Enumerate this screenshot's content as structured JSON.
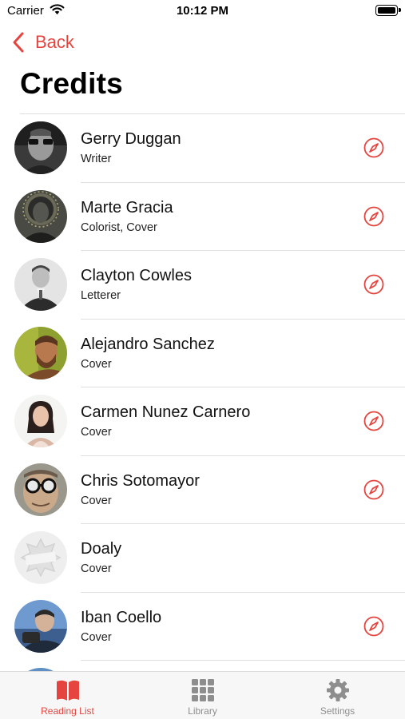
{
  "status_bar": {
    "carrier": "Carrier",
    "time": "10:12 PM"
  },
  "nav": {
    "back_label": "Back",
    "title": "Credits"
  },
  "colors": {
    "accent": "#e6453f",
    "inactive": "#8e8e8e"
  },
  "credits": [
    {
      "name": "Gerry Duggan",
      "role": "Writer",
      "has_link": true,
      "avatar": "portrait-dark-glasses"
    },
    {
      "name": "Marte Gracia",
      "role": "Colorist, Cover",
      "has_link": true,
      "avatar": "portrait-illustrated"
    },
    {
      "name": "Clayton Cowles",
      "role": "Letterer",
      "has_link": true,
      "avatar": "portrait-suit-bw"
    },
    {
      "name": "Alejandro Sanchez",
      "role": "Cover",
      "has_link": false,
      "avatar": "portrait-green-bg"
    },
    {
      "name": "Carmen Nunez Carnero",
      "role": "Cover",
      "has_link": true,
      "avatar": "portrait-woman"
    },
    {
      "name": "Chris Sotomayor",
      "role": "Cover",
      "has_link": true,
      "avatar": "portrait-round-glasses"
    },
    {
      "name": "Doaly",
      "role": "Cover",
      "has_link": false,
      "avatar": "blank-placeholder"
    },
    {
      "name": "Iban Coello",
      "role": "Cover",
      "has_link": true,
      "avatar": "portrait-blue-bg"
    }
  ],
  "tabs": [
    {
      "label": "Reading List",
      "icon": "book-icon",
      "active": true
    },
    {
      "label": "Library",
      "icon": "grid-icon",
      "active": false
    },
    {
      "label": "Settings",
      "icon": "gear-icon",
      "active": false
    }
  ]
}
